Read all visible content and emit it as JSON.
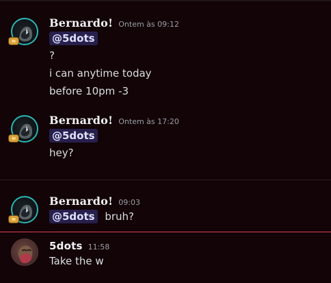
{
  "messages": [
    {
      "author": "Bernardo!",
      "timestamp": "Ontem às 09:12",
      "mention": "@5dots",
      "lines": [
        "?",
        "i can anytime today",
        "before 10pm -3"
      ]
    },
    {
      "author": "Bernardo!",
      "timestamp": "Ontem às 17:20",
      "mention": "@5dots",
      "lines": [
        "hey?"
      ]
    },
    {
      "author": "Bernardo!",
      "timestamp": "09:03",
      "mention": "@5dots",
      "inline_text": "bruh?"
    },
    {
      "author": "5dots",
      "timestamp": "11:58",
      "lines": [
        "Take the w"
      ]
    }
  ],
  "icons": {
    "bernardo_avatar": "avatar-icon",
    "5dots_avatar": "avatar-icon",
    "badge": "badge-icon"
  },
  "colors": {
    "background": "#120407",
    "mention_bg": "#3b3f7a",
    "new_divider": "#e0434a",
    "bernardo_ring": "#2bb7b3"
  }
}
